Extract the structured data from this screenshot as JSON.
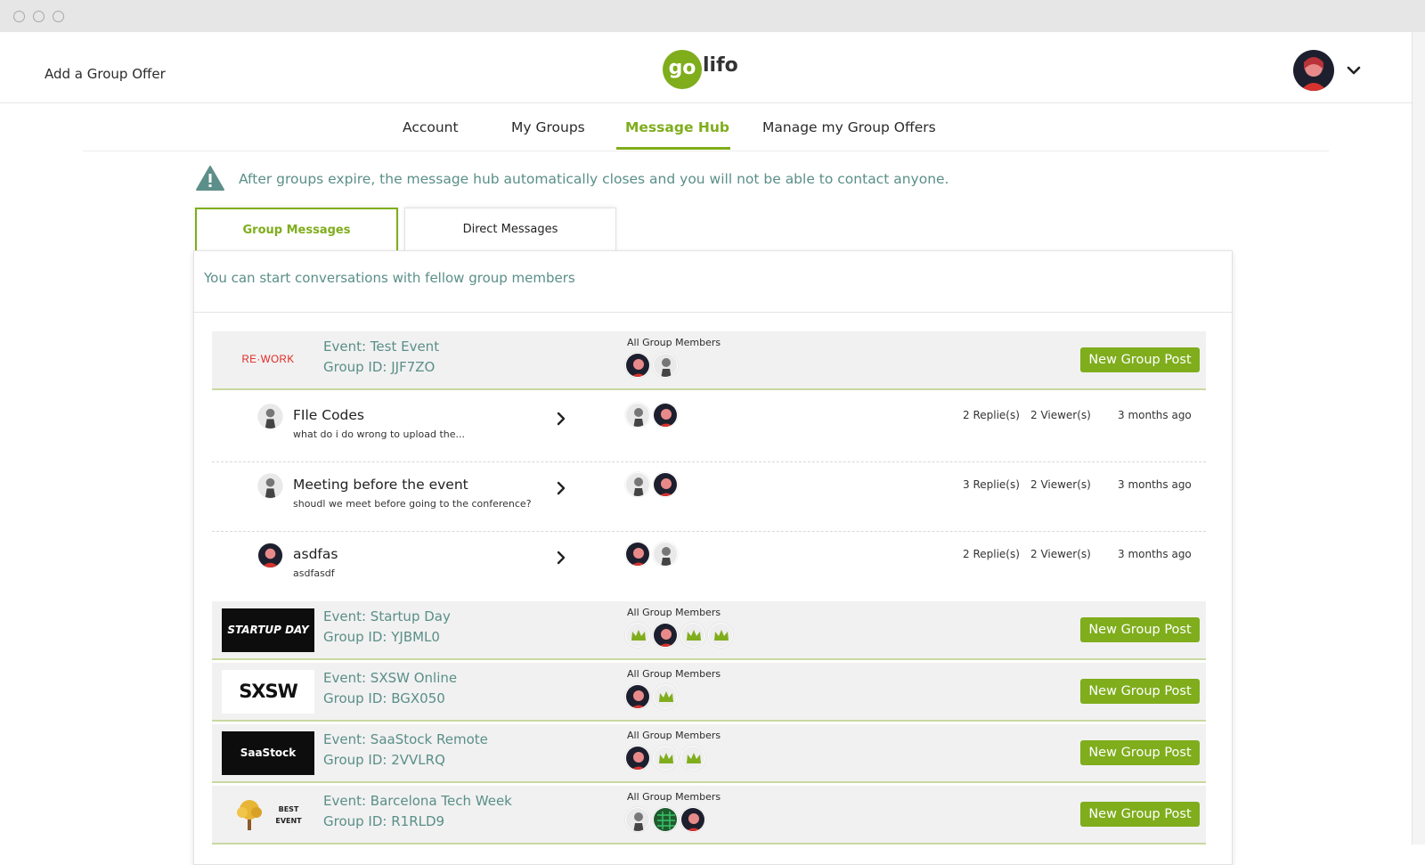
{
  "header": {
    "add_offer": "Add a Group Offer",
    "logo_go": "go",
    "logo_life": "lifo"
  },
  "nav": {
    "items": [
      "Account",
      "My Groups",
      "Message Hub",
      "Manage my Group Offers"
    ],
    "active": "Message Hub"
  },
  "notice": "After groups expire, the message hub automatically closes and you will not be able to contact anyone.",
  "tabs": [
    "Group Messages",
    "Direct Messages"
  ],
  "intro": "You can start conversations with fellow group members",
  "members_label": "All Group Members",
  "new_post_label": "New Group Post",
  "groups": [
    {
      "event": "Event: Test Event",
      "group_id": "Group ID: JJF7ZO",
      "logo": "RE·WORK"
    },
    {
      "event": "Event: Startup Day",
      "group_id": "Group ID: YJBML0",
      "logo": "STARTUP DAY"
    },
    {
      "event": "Event: SXSW Online",
      "group_id": "Group ID: BGX050",
      "logo": "SXSW"
    },
    {
      "event": "Event: SaaStock Remote",
      "group_id": "Group ID: 2VVLRQ",
      "logo": "SaaStock REMOTE"
    },
    {
      "event": "Event: Barcelona Tech Week",
      "group_id": "Group ID: R1RLD9",
      "logo": "BEST EVENT"
    }
  ],
  "posts": [
    {
      "title": "FIle Codes",
      "preview": "what do i do wrong to upload the...",
      "replies": "2 Replie(s)",
      "viewers": "2 Viewer(s)",
      "time": "3 months ago"
    },
    {
      "title": "Meeting before the event",
      "preview": "shoudl we meet before going to the conference?",
      "replies": "3 Replie(s)",
      "viewers": "2 Viewer(s)",
      "time": "3 months ago"
    },
    {
      "title": "asdfas",
      "preview": "asdfasdf",
      "replies": "2 Replie(s)",
      "viewers": "2 Viewer(s)",
      "time": "3 months ago"
    }
  ],
  "colors": {
    "brand_green": "#7fad1c",
    "teal_text": "#5a8f87",
    "warning_icon": "#5d8f8a"
  }
}
